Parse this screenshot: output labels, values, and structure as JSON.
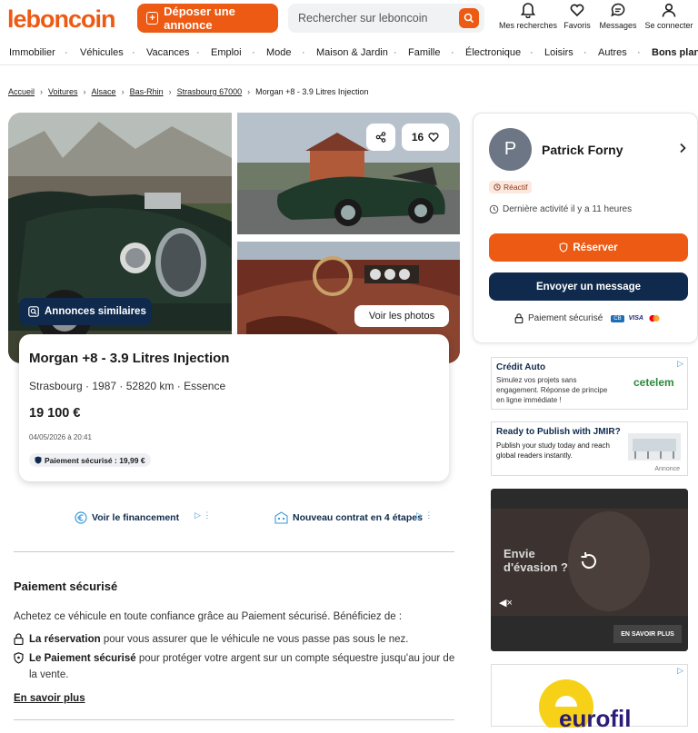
{
  "header": {
    "logo": "leboncoin",
    "post_label": "Déposer une annonce",
    "search_placeholder": "Rechercher sur leboncoin",
    "icons": [
      {
        "label": "Mes recherches",
        "icon": "bell-icon"
      },
      {
        "label": "Favoris",
        "icon": "heart-icon"
      },
      {
        "label": "Messages",
        "icon": "chat-icon"
      },
      {
        "label": "Se connecter",
        "icon": "user-icon"
      }
    ],
    "accent": "#ec5a13",
    "navy": "#0f2a4d"
  },
  "nav": [
    "Immobilier",
    "Véhicules",
    "Vacances",
    "Emploi",
    "Mode",
    "Maison & Jardin",
    "Famille",
    "Électronique",
    "Loisirs",
    "Autres",
    "Bons plans"
  ],
  "breadcrumb": [
    "Accueil",
    "Voitures",
    "Alsace",
    "Bas-Rhin",
    "Strasbourg 67000",
    "Morgan +8 - 3.9 Litres Injection"
  ],
  "photos": {
    "similar_label": "Annonces similaires",
    "see_photos_label": "Voir les photos",
    "fav_count": "16"
  },
  "listing": {
    "title": "Morgan +8 - 3.9 Litres Injection",
    "subtitle": "Strasbourg · 1987 · 52820 km · Essence",
    "price": "19 100 €",
    "date": "04/05/2026 à 20:41",
    "payment_badge": "Paiement sécurisé : 19,99 €"
  },
  "links": {
    "financing": "Voir le financement",
    "contract": "Nouveau contrat en 4 étapes"
  },
  "paiement": {
    "title": "Paiement sécurisé",
    "intro": "Achetez ce véhicule en toute confiance grâce au Paiement sécurisé. Bénéficiez de :",
    "item1_bold": "La réservation",
    "item1_rest": " pour vous assurer que le véhicule ne vous passe pas sous le nez.",
    "item2_bold": "Le Paiement sécurisé",
    "item2_rest": " pour protéger votre argent sur un compte séquestre jusqu'au jour de la vente.",
    "more": "En savoir plus"
  },
  "seller": {
    "initial": "P",
    "name": "Patrick Forny",
    "badge": "Réactif",
    "activity": "Dernière activité il y a 11 heures",
    "reserve_label": "Réserver",
    "message_label": "Envoyer un message",
    "secure_label": "Paiement sécurisé",
    "card_brands": [
      "CB",
      "VISA",
      "MC"
    ]
  },
  "ads": {
    "ad1_title": "Crédit Auto",
    "ad1_text": "Simulez vos projets sans engagement. Réponse de principe en ligne immédiate !",
    "ad1_brand": "cetelem",
    "ad2_title": "Ready to Publish with JMIR?",
    "ad2_text": "Publish your study today and reach global readers instantly.",
    "ad2_tag": "Annonce",
    "ad3_text": "Envie d'évasion ?",
    "ad3_cta": "EN SAVOIR PLUS",
    "ad4_brand": "eurofil"
  }
}
